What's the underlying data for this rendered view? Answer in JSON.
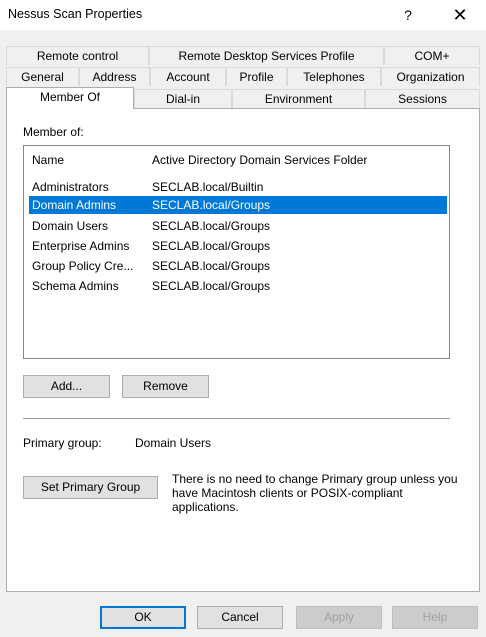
{
  "window": {
    "title": "Nessus Scan Properties",
    "help_glyph": "?",
    "close_glyph": "✕"
  },
  "tabs": {
    "row1": [
      "Remote control",
      "Remote Desktop Services Profile",
      "COM+"
    ],
    "row2": [
      "General",
      "Address",
      "Account",
      "Profile",
      "Telephones",
      "Organization"
    ],
    "row3": [
      "Member Of",
      "Dial-in",
      "Environment",
      "Sessions"
    ],
    "active": "Member Of"
  },
  "member_of": {
    "label": "Member of:",
    "columns": [
      "Name",
      "Active Directory Domain Services Folder"
    ],
    "rows": [
      {
        "name": "Administrators",
        "folder": "SECLAB.local/Builtin"
      },
      {
        "name": "Domain Admins",
        "folder": "SECLAB.local/Groups"
      },
      {
        "name": "Domain Users",
        "folder": "SECLAB.local/Groups"
      },
      {
        "name": "Enterprise Admins",
        "folder": "SECLAB.local/Groups"
      },
      {
        "name": "Group Policy Cre...",
        "folder": "SECLAB.local/Groups"
      },
      {
        "name": "Schema Admins",
        "folder": "SECLAB.local/Groups"
      }
    ],
    "selected_row": "Domain Admins"
  },
  "buttons": {
    "add": "Add...",
    "remove": "Remove",
    "set_primary": "Set Primary Group",
    "ok": "OK",
    "cancel": "Cancel",
    "apply": "Apply",
    "help": "Help"
  },
  "primary_group": {
    "label": "Primary group:",
    "value": "Domain Users",
    "note": "There is no need to change Primary group unless you have Macintosh clients or POSIX-compliant applications."
  },
  "colors": {
    "selection": "#0078d7",
    "default_button_border": "#0078d7"
  }
}
